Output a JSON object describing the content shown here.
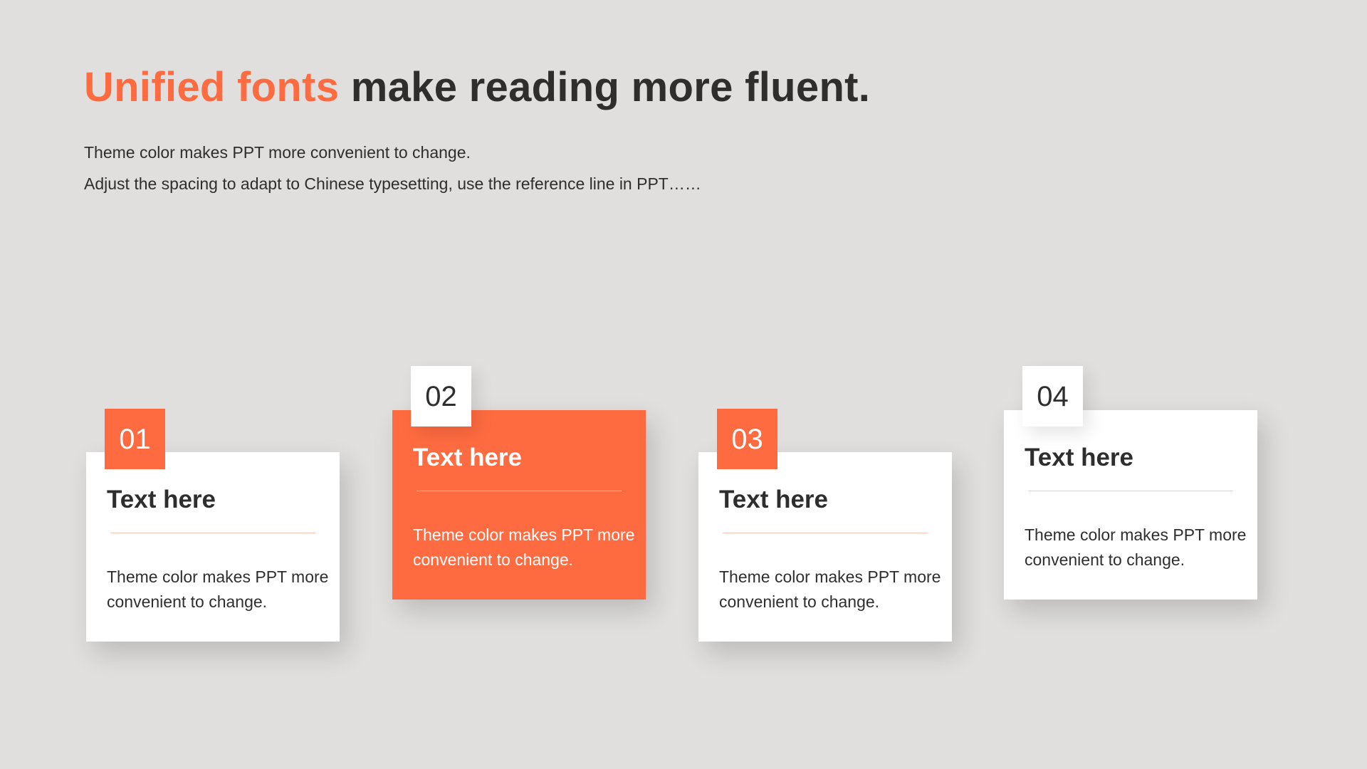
{
  "header": {
    "title_accent": "Unified fonts",
    "title_rest": " make reading more fluent.",
    "subtitle_line1": "Theme color makes PPT more convenient to change.",
    "subtitle_line2": "Adjust the spacing to adapt to Chinese typesetting, use the reference line in PPT……"
  },
  "cards": [
    {
      "number": "01",
      "title": "Text here",
      "body": "Theme color makes PPT more convenient to change."
    },
    {
      "number": "02",
      "title": "Text here",
      "body": "Theme color makes PPT more convenient to change."
    },
    {
      "number": "03",
      "title": "Text here",
      "body": "Theme color makes PPT more convenient to change."
    },
    {
      "number": "04",
      "title": "Text here",
      "body": "Theme color makes PPT more convenient to change."
    }
  ],
  "colors": {
    "accent": "#ff6b40",
    "background": "#e0dfdd",
    "text": "#2e2e2e",
    "card": "#ffffff"
  }
}
